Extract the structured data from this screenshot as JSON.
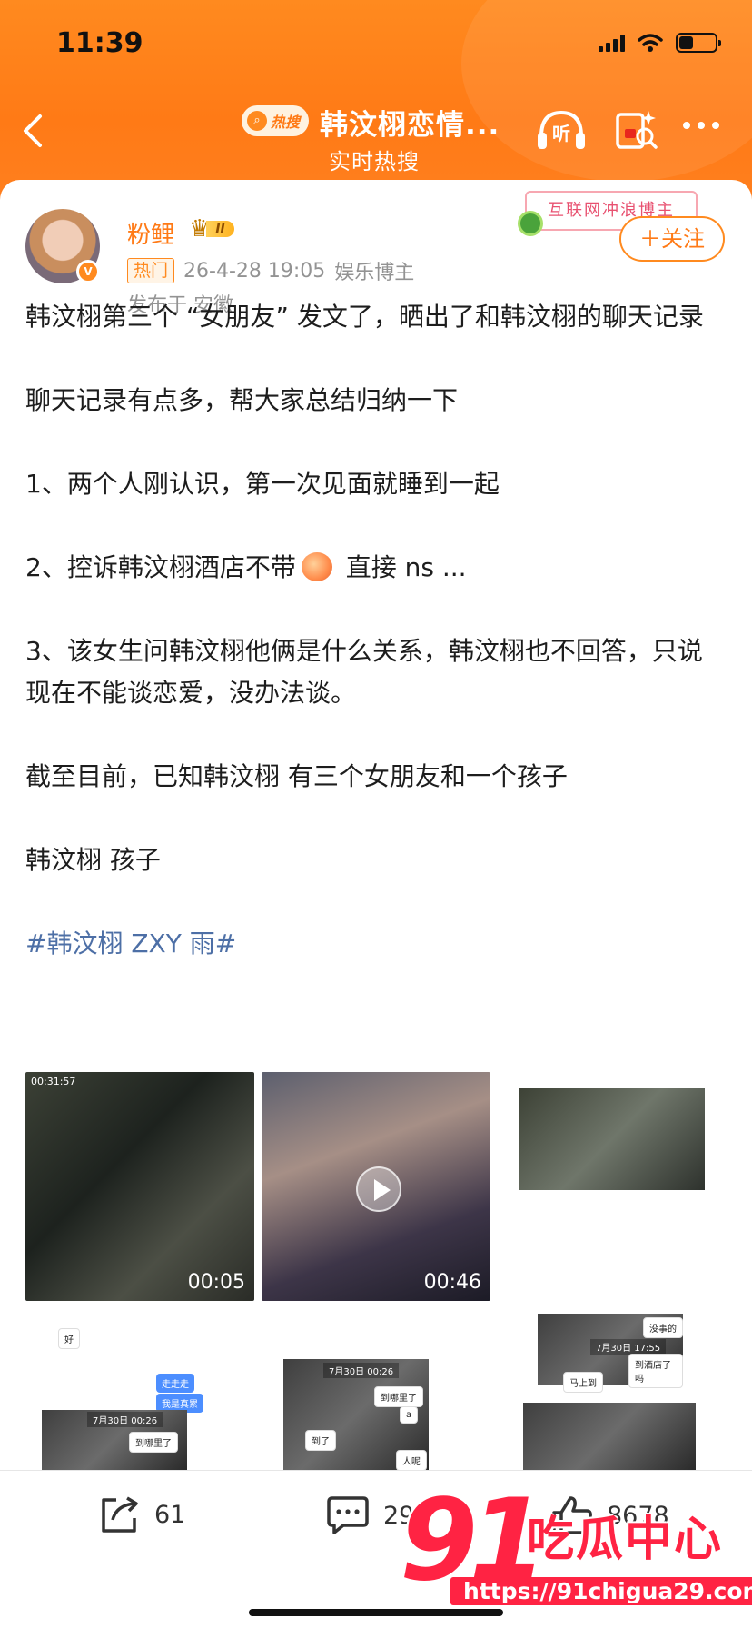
{
  "status": {
    "time": "11:39"
  },
  "header": {
    "hot_pill": "热搜",
    "title": "韩汶栩恋情...",
    "subtitle": "实时热搜",
    "listen_label": "听"
  },
  "post": {
    "author": "粉鲤",
    "vip_level": "II",
    "hot_tag": "热门",
    "timestamp": "26-4-28 19:05",
    "author_type": "娱乐博主",
    "location": "发布于 安徽",
    "banner_text": "互联网冲浪博主",
    "follow_label": "＋关注",
    "paragraphs": [
      "韩汶栩第三个 “女朋友” 发文了，晒出了和韩汶栩的聊天记录",
      "聊天记录有点多，帮大家总结归纳一下",
      "1、两个人刚认识，第一次见面就睡到一起",
      "2、控诉韩汶栩酒店不带",
      "直接 ns ...",
      "3、该女生问韩汶栩他俩是什么关系，韩汶栩也不回答，只说现在不能谈恋爱，没办法谈。",
      "截至目前，已知韩汶栩 有三个女朋友和一个孩子",
      "韩汶栩 孩子"
    ],
    "hashtag": "#韩汶栩 ZXY 雨#",
    "media": {
      "v1_time": "00:31:57",
      "v1_duration": "00:05",
      "v2_duration": "00:46",
      "chat_bubbles": [
        "好",
        "走走走",
        "我是真累",
        "到哪里了",
        "a",
        "到了",
        "人呢",
        "没事的",
        "到酒店了吗",
        "马上到"
      ],
      "stamp": "7月30日 00:26",
      "stamp2": "7月30日 17:55"
    }
  },
  "actions": {
    "share_count": "61",
    "comment_count": "29",
    "like_count": "8678"
  },
  "watermark": {
    "big": "91",
    "cn": "吃瓜中心",
    "url": "https://91chigua29.com"
  }
}
